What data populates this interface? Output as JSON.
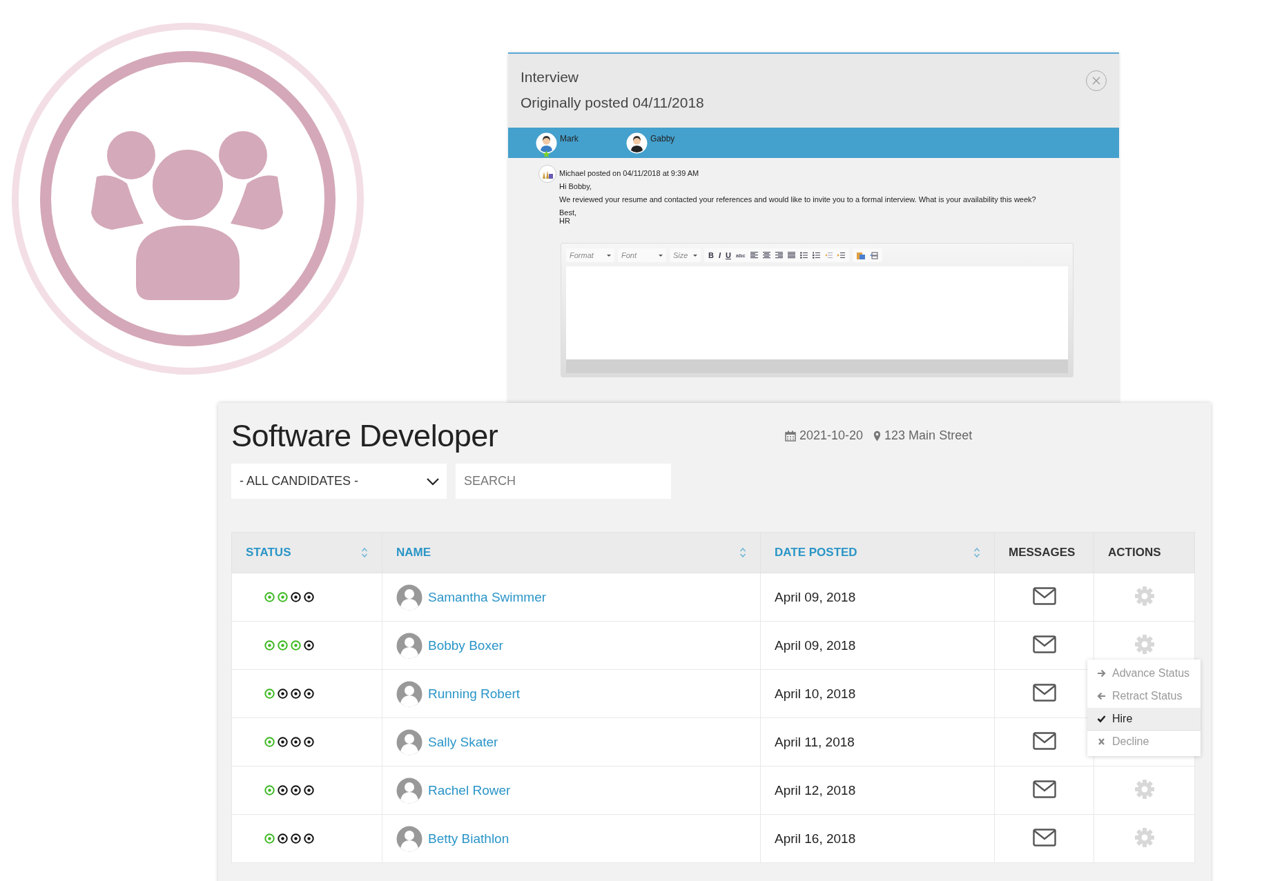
{
  "interview": {
    "title": "Interview",
    "subtitle": "Originally posted 04/11/2018",
    "participants": [
      {
        "name": "Mark",
        "starred": true
      },
      {
        "name": "Gabby",
        "starred": false
      }
    ],
    "message": {
      "author": "Michael",
      "meta": "posted on 04/11/2018 at 9:39 AM",
      "paragraphs": [
        [
          "Hi Bobby,"
        ],
        [
          "We reviewed your resume and contacted your references and would like to invite you to a formal interview. What is your availability this week?"
        ],
        [
          "Best,",
          "HR"
        ]
      ]
    },
    "editor": {
      "dropdowns": [
        "Format",
        "Font",
        "Size"
      ],
      "format_buttons": [
        "B",
        "I",
        "U",
        "abc"
      ]
    }
  },
  "job": {
    "title": "Software Developer",
    "date": "2021-10-20",
    "location": "123 Main Street",
    "filter": "- ALL CANDIDATES -",
    "search_placeholder": "SEARCH"
  },
  "table": {
    "columns": [
      {
        "label": "STATUS",
        "sortable": true
      },
      {
        "label": "NAME",
        "sortable": true
      },
      {
        "label": "DATE POSTED",
        "sortable": true
      },
      {
        "label": "MESSAGES",
        "sortable": false
      },
      {
        "label": "ACTIONS",
        "sortable": false
      }
    ],
    "rows": [
      {
        "stages": [
          {
            "on": true
          },
          {
            "on": true
          },
          {
            "on": false
          },
          {
            "on": false
          }
        ],
        "name": "Samantha Swimmer",
        "date": "April 09, 2018"
      },
      {
        "stages": [
          {
            "on": true
          },
          {
            "on": true
          },
          {
            "on": true
          },
          {
            "on": false
          }
        ],
        "name": "Bobby Boxer",
        "date": "April 09, 2018",
        "menu": [
          {
            "kind": "advance",
            "label": "Advance Status",
            "selected": false
          },
          {
            "kind": "retract",
            "label": "Retract Status",
            "selected": false
          },
          {
            "kind": "hire",
            "label": "Hire",
            "selected": true
          },
          {
            "kind": "decline",
            "label": "Decline",
            "selected": false
          }
        ]
      },
      {
        "stages": [
          {
            "on": true
          },
          {
            "on": false
          },
          {
            "on": false
          },
          {
            "on": false
          }
        ],
        "name": "Running Robert",
        "date": "April 10, 2018"
      },
      {
        "stages": [
          {
            "on": true
          },
          {
            "on": false
          },
          {
            "on": false
          },
          {
            "on": false
          }
        ],
        "name": "Sally Skater",
        "date": "April 11, 2018"
      },
      {
        "stages": [
          {
            "on": true
          },
          {
            "on": false
          },
          {
            "on": false
          },
          {
            "on": false
          }
        ],
        "name": "Rachel Rower",
        "date": "April 12, 2018"
      },
      {
        "stages": [
          {
            "on": true
          },
          {
            "on": false
          },
          {
            "on": false
          },
          {
            "on": false
          }
        ],
        "name": "Betty Biathlon",
        "date": "April 16, 2018"
      }
    ]
  }
}
